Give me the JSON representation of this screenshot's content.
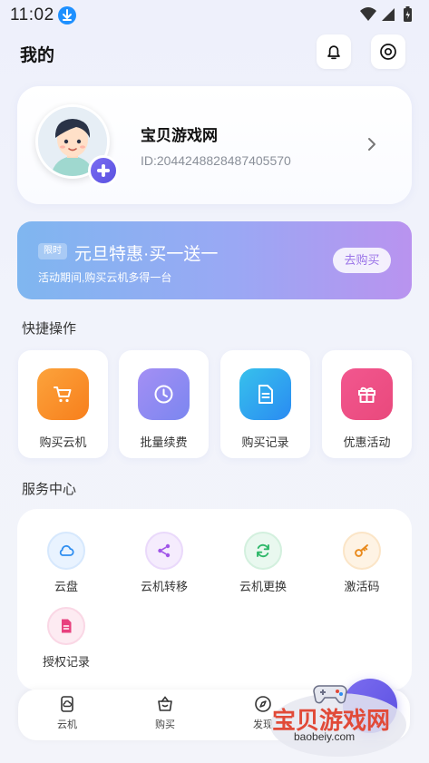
{
  "status_bar": {
    "time": "11:02"
  },
  "header": {
    "title": "我的"
  },
  "profile": {
    "name": "宝贝游戏网",
    "id_text": "ID:2044248828487405570"
  },
  "promo": {
    "tag": "限时",
    "title": "元旦特惠·买一送一",
    "subtitle": "活动期间,购买云机多得一台",
    "button": "去购买"
  },
  "quick_actions": {
    "title": "快捷操作",
    "items": [
      {
        "label": "购买云机",
        "icon": "cart-icon",
        "color": "#f9962a"
      },
      {
        "label": "批量续费",
        "icon": "clock-icon",
        "color": "#8f86f3"
      },
      {
        "label": "购买记录",
        "icon": "document-icon",
        "color": "#2f9cf2"
      },
      {
        "label": "优惠活动",
        "icon": "gift-icon",
        "color": "#ef4d88"
      }
    ]
  },
  "services": {
    "title": "服务中心",
    "items": [
      {
        "label": "云盘",
        "icon": "cloud-icon",
        "color": "#2f8ef0"
      },
      {
        "label": "云机转移",
        "icon": "share-icon",
        "color": "#a055e8"
      },
      {
        "label": "云机更换",
        "icon": "refresh-icon",
        "color": "#2fb86a"
      },
      {
        "label": "激活码",
        "icon": "key-icon",
        "color": "#e98a1c"
      },
      {
        "label": "授权记录",
        "icon": "file-icon",
        "color": "#e8407e"
      }
    ]
  },
  "bottom_nav": {
    "items": [
      {
        "label": "云机",
        "icon": "cloud-phone-icon"
      },
      {
        "label": "购买",
        "icon": "basket-icon"
      },
      {
        "label": "发现",
        "icon": "compass-icon"
      }
    ]
  },
  "watermark": {
    "text": "宝贝游戏网",
    "url": "baobeiy.com"
  }
}
